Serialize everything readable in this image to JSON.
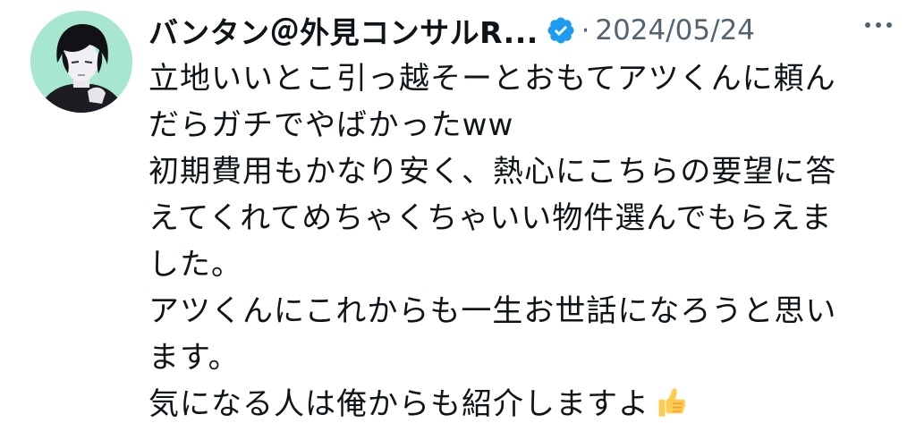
{
  "author": {
    "display_name": "バンタン＠外見コンサルR...",
    "verified": true,
    "avatar_icon": "profile-avatar"
  },
  "meta": {
    "separator": "·",
    "date": "2024/05/24"
  },
  "more_icon": "more-horizontal-icon",
  "tweet": {
    "lines": [
      "立地いいとこ引っ越そーとおもてアツくんに頼ん",
      "だらガチでやばかったww",
      "初期費用もかなり安く、熱心にこちらの要望に答",
      "えてくれてめちゃくちゃいい物件選んでもらえま",
      "した。",
      "アツくんにこれからも一生お世話になろうと思い",
      "ます。",
      "気になる人は俺からも紹介しますよ"
    ],
    "trailing_emoji": "thumbs-up-emoji"
  },
  "colors": {
    "text": "#0f1419",
    "secondary": "#536471",
    "verified": "#1d9bf0",
    "avatar_bg": "#a7e6cf"
  }
}
